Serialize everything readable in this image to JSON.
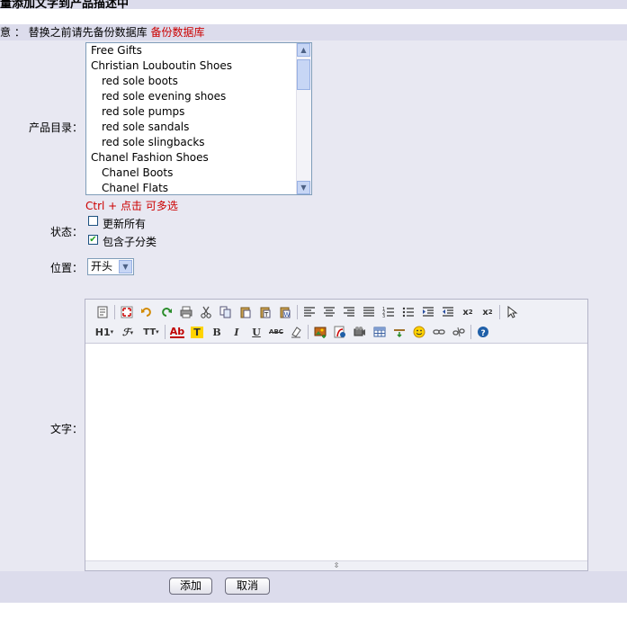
{
  "header": {
    "title": "量添加文字到产品描述中",
    "notice_prefix": "意 ： 替换之前请先备份数据库",
    "notice_link": "备份数据库"
  },
  "form": {
    "category_label": "产品目录：",
    "categories": [
      {
        "label": "Free Gifts",
        "level": 0
      },
      {
        "label": "Christian Louboutin Shoes",
        "level": 0
      },
      {
        "label": "red sole boots",
        "level": 1
      },
      {
        "label": "red sole evening shoes",
        "level": 1
      },
      {
        "label": "red sole pumps",
        "level": 1
      },
      {
        "label": "red sole sandals",
        "level": 1
      },
      {
        "label": "red sole slingbacks",
        "level": 1
      },
      {
        "label": "Chanel Fashion Shoes",
        "level": 0
      },
      {
        "label": "Chanel Boots",
        "level": 1
      },
      {
        "label": "Chanel Flats",
        "level": 1
      }
    ],
    "multi_select_hint": "Ctrl + 点击 可多选",
    "status_label": "状态：",
    "update_all_label": "更新所有",
    "update_all_checked": false,
    "include_sub_label": "包含子分类",
    "include_sub_checked": true,
    "position_label": "位置：",
    "position_value": "开头",
    "text_label": "文字："
  },
  "editor": {
    "row1": [
      "source-icon",
      "sep",
      "fullscreen-icon",
      "undo-icon",
      "redo-icon",
      "print-icon",
      "cut-icon",
      "copy-icon",
      "paste-icon",
      "paste-text-icon",
      "paste-word-icon",
      "sep",
      "align-left-icon",
      "align-center-icon",
      "align-right-icon",
      "align-justify-icon",
      "ordered-list-icon",
      "unordered-list-icon",
      "indent-icon",
      "outdent-icon",
      "subscript-icon",
      "superscript-icon",
      "sep",
      "select-all-icon"
    ],
    "row2": [
      "heading-icon",
      "font-family-icon",
      "font-size-icon",
      "sep",
      "text-color-icon",
      "highlight-icon",
      "bold-icon",
      "italic-icon",
      "underline-icon",
      "strikethrough-icon",
      "remove-format-icon",
      "sep",
      "image-icon",
      "flash-icon",
      "media-icon",
      "table-icon",
      "hr-icon",
      "emoticon-icon",
      "link-icon",
      "unlink-icon",
      "sep",
      "help-icon"
    ],
    "heading_text": "H1",
    "fontsize_text": "TT",
    "textcolor_text": "Ab",
    "highlight_text": "T",
    "bold_text": "B",
    "italic_text": "I",
    "underline_text": "U",
    "strike_text": "ABC"
  },
  "actions": {
    "add_label": "添加",
    "cancel_label": "取消"
  },
  "colors": {
    "header_bg": "#dcdcec",
    "form_bg": "#e8e8f2",
    "warning": "#cc0000"
  }
}
